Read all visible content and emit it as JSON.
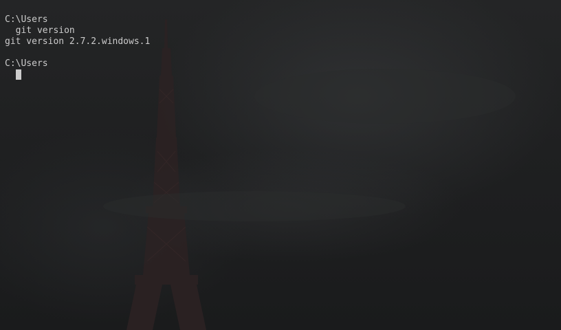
{
  "console": {
    "lines": [
      "C:\\Users",
      "  git version",
      "git version 2.7.2.windows.1",
      "",
      "C:\\Users"
    ]
  },
  "colors": {
    "text": "#cccccc",
    "background": "#1c1d1e",
    "tower": "#2e2223"
  },
  "background_image": "eiffel-tower-night-photo"
}
